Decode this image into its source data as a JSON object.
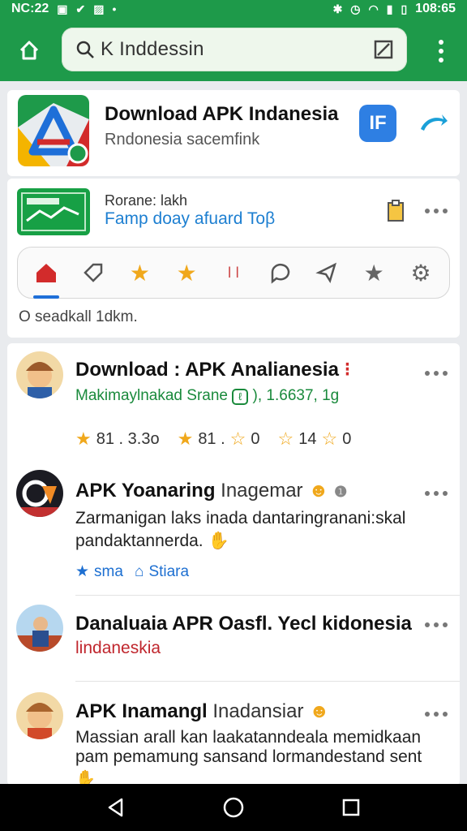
{
  "status_bar": {
    "time_left": "NC:22",
    "time_right": "108:65"
  },
  "search": {
    "query": "K  Inddessin"
  },
  "app_card": {
    "title": "Download APK Indanesia",
    "subtitle": "Rndonesia sacemfink",
    "fb_label": "IF"
  },
  "promo_card": {
    "label": "Rorane: lakh",
    "link": "Famp doay afuard Toβ",
    "footer": "O seadkall 1dkm."
  },
  "posts": [
    {
      "title": "Download : APK  Analianesia",
      "line1": "Makimaylnakad Srane",
      "line1_extra": "), 1.6637, 1g",
      "ratings": [
        "81 . 3.3o",
        "81 .",
        "0",
        "14",
        "0"
      ]
    },
    {
      "title": "APK Yoanaring",
      "title_light": " Inagemar",
      "line1": "Zarmanigan laks inada dantaringranani:skal",
      "line2": "pandaktannerda.",
      "tags": [
        "sma",
        "Stiara"
      ]
    },
    {
      "title": "Danaluaia APR Oasfl. Yecl kidonesia",
      "line1": "lindaneskia"
    },
    {
      "title": "APK  Inamangl",
      "title_light": " Inadansiar",
      "line1": "Massian arall kan laakatanndeala memidkaan",
      "line2": "pam pemamung sansand lormandestand sent"
    }
  ],
  "colors": {
    "brand_green": "#1e9a4a",
    "link_blue": "#1d7fd1",
    "star": "#f0a81c",
    "accent_red": "#d22b2b"
  }
}
